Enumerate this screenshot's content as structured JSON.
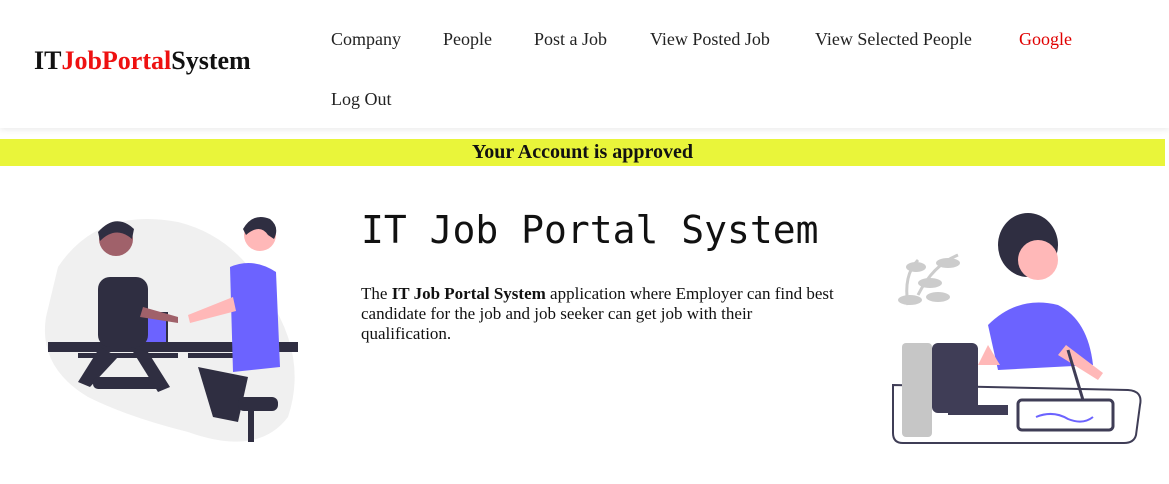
{
  "brand": {
    "part1": "IT",
    "part2": "JobPortal",
    "part3": "System"
  },
  "nav": {
    "company": "Company",
    "people": "People",
    "post_job": "Post a Job",
    "view_posted": "View Posted Job",
    "view_selected": "View Selected People",
    "google": "Google",
    "logout": "Log Out"
  },
  "banner": {
    "text": "Your Account is approved"
  },
  "hero": {
    "title": "IT Job Portal System",
    "desc_prefix": "The ",
    "desc_bold": "IT Job Portal System",
    "desc_rest": " application where Employer can find best candidate for the job and job seeker can get job with their qualification."
  },
  "colors": {
    "accent_red": "#ee1111",
    "banner_bg": "#e9f53a",
    "illustration_purple": "#6c63ff"
  },
  "icons": {
    "left": "handshake-illustration",
    "right": "designer-at-desk-illustration"
  }
}
